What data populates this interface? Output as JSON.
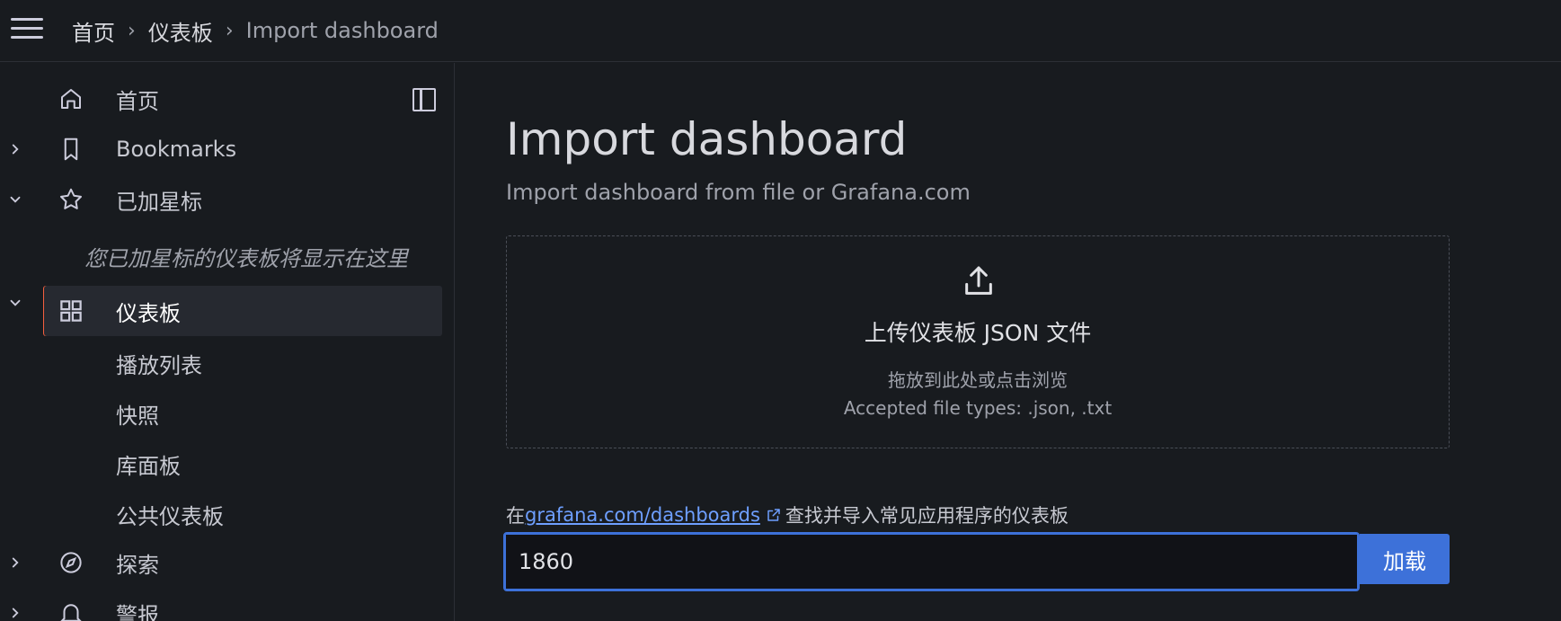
{
  "breadcrumb": {
    "items": [
      "首页",
      "仪表板"
    ],
    "current": "Import dashboard"
  },
  "sidebar": {
    "items": [
      {
        "label": "首页",
        "icon": "home-icon"
      },
      {
        "label": "Bookmarks",
        "icon": "bookmark-icon"
      },
      {
        "label": "已加星标",
        "icon": "star-icon"
      },
      {
        "label": "仪表板",
        "icon": "grid-icon"
      },
      {
        "label": "探索",
        "icon": "compass-icon"
      },
      {
        "label": "警报",
        "icon": "bell-icon"
      }
    ],
    "starred_hint": "您已加星标的仪表板将显示在这里",
    "dashboard_children": [
      "播放列表",
      "快照",
      "库面板",
      "公共仪表板"
    ]
  },
  "main": {
    "title": "Import dashboard",
    "subtitle": "Import dashboard from file or Grafana.com",
    "upload": {
      "title": "上传仪表板 JSON 文件",
      "hint": "拖放到此处或点击浏览",
      "types": "Accepted file types: .json, .txt"
    },
    "gcom": {
      "prefix": "在",
      "link": "grafana.com/dashboards",
      "suffix": "查找并导入常见应用程序的仪表板",
      "input_value": "1860",
      "load_label": "加载"
    }
  },
  "colors": {
    "accent": "#3d71d9",
    "active_marker": "#f55f3e",
    "link": "#6e9fff"
  }
}
